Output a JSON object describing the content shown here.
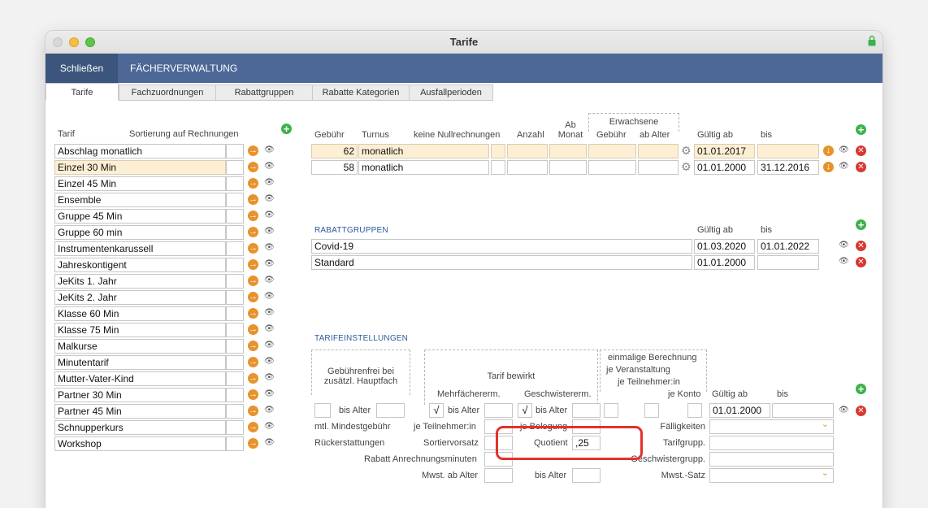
{
  "window": {
    "title": "Tarife"
  },
  "menubar": {
    "close_label": "Schließen",
    "subject_label": "FÄCHERVERWALTUNG"
  },
  "tabs": [
    "Tarife",
    "Fachzuordnungen",
    "Rabattgruppen",
    "Rabatte Kategorien",
    "Ausfallperioden"
  ],
  "tariffs": {
    "header_tarif": "Tarif",
    "header_sort": "Sortierung auf Rechnungen",
    "items": [
      "Abschlag monatlich",
      "Einzel 30 Min",
      "Einzel 45 Min",
      "Ensemble",
      "Gruppe 45 Min",
      "Gruppe 60 min",
      "Instrumentenkarussell",
      "Jahreskontigent",
      "JeKits 1. Jahr",
      "JeKits 2. Jahr",
      "Klasse 60 Min",
      "Klasse 75 Min",
      "Malkurse",
      "Minutentarif",
      "Mutter-Vater-Kind",
      "Partner 30 Min",
      "Partner 45 Min",
      "Schnupperkurs",
      "Workshop"
    ],
    "selected_index": 1
  },
  "fees": {
    "headers": {
      "gebuehr": "Gebühr",
      "turnus": "Turnus",
      "keine_null": "keine Nullrechnungen",
      "anzahl": "Anzahl",
      "ab_monat_1": "Ab",
      "ab_monat_2": "Monat",
      "erwachsene": "Erwachsene",
      "erw_gebuehr": "Gebühr",
      "ab_alter": "ab Alter",
      "gueltig_ab": "Gültig ab",
      "bis": "bis"
    },
    "rows": [
      {
        "gebuehr": "62",
        "turnus": "monatlich",
        "gueltig_ab": "01.01.2017",
        "bis": ""
      },
      {
        "gebuehr": "58",
        "turnus": "monatlich",
        "gueltig_ab": "01.01.2000",
        "bis": "31.12.2016"
      }
    ]
  },
  "discount_groups": {
    "title": "RABATTGRUPPEN",
    "gueltig_ab": "Gültig ab",
    "bis": "bis",
    "rows": [
      {
        "name": "Covid-19",
        "gueltig_ab": "01.03.2020",
        "bis": "01.01.2022"
      },
      {
        "name": "Standard",
        "gueltig_ab": "01.01.2000",
        "bis": ""
      }
    ]
  },
  "settings": {
    "title": "TARIFEINSTELLUNGEN",
    "gebuehrenfrei_1": "Gebührenfrei bei",
    "gebuehrenfrei_2": "zusätzl. Hauptfach",
    "tarif_bewirkt": "Tarif bewirkt",
    "mehrfach": "Mehrfächererm.",
    "geschwister": "Geschwistererm.",
    "einmalig_1": "einmalige Berechnung",
    "einmalig_2": "je Veranstaltung",
    "einmalig_3": "je Teilnehmer:in",
    "je_konto": "je Konto",
    "gueltig_ab": "Gültig ab",
    "bis": "bis",
    "bis_alter": "bis Alter",
    "gueltig_ab_value": "01.01.2000",
    "check1": "√",
    "check2": "√",
    "mtl_mindest": "mtl. Mindestgebühr",
    "je_teilnehmer": "je Teilnehmer:in",
    "je_belegung": "je Belegung",
    "faelligkeiten": "Fälligkeiten",
    "rueckerstattungen": "Rückerstattungen",
    "sortiervorsatz": "Sortiervorsatz",
    "quotient": "Quotient",
    "quotient_value": ",25",
    "tarifgrupp": "Tarifgrupp.",
    "rabatt_minuten": "Rabatt Anrechnungsminuten",
    "geschwistergrupp": "Geschwistergrupp.",
    "mwst_ab_alter": "Mwst. ab Alter",
    "bis_alter2": "bis Alter",
    "mwst_satz": "Mwst.-Satz"
  },
  "icons": {
    "arrow": "arrow-right-icon",
    "eye": "eye-icon",
    "add": "plus-icon",
    "delete": "close-icon",
    "gear": "gear-icon",
    "down": "arrow-down-icon"
  }
}
